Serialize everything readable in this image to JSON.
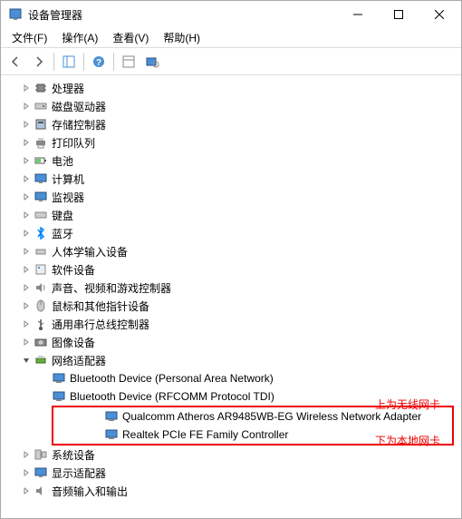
{
  "titlebar": {
    "title": "设备管理器"
  },
  "menubar": {
    "file": "文件(F)",
    "action": "操作(A)",
    "view": "查看(V)",
    "help": "帮助(H)"
  },
  "tree": {
    "items": [
      {
        "label": "处理器"
      },
      {
        "label": "磁盘驱动器"
      },
      {
        "label": "存储控制器"
      },
      {
        "label": "打印队列"
      },
      {
        "label": "电池"
      },
      {
        "label": "计算机"
      },
      {
        "label": "监视器"
      },
      {
        "label": "键盘"
      },
      {
        "label": "蓝牙"
      },
      {
        "label": "人体学输入设备"
      },
      {
        "label": "软件设备"
      },
      {
        "label": "声音、视频和游戏控制器"
      },
      {
        "label": "鼠标和其他指针设备"
      },
      {
        "label": "通用串行总线控制器"
      },
      {
        "label": "图像设备"
      },
      {
        "label": "网络适配器"
      },
      {
        "label": "系统设备"
      },
      {
        "label": "显示适配器"
      },
      {
        "label": "音频输入和输出"
      }
    ],
    "network_children": [
      {
        "label": "Bluetooth Device (Personal Area Network)"
      },
      {
        "label": "Bluetooth Device (RFCOMM Protocol TDI)"
      },
      {
        "label": "Qualcomm Atheros AR9485WB-EG Wireless Network Adapter"
      },
      {
        "label": "Realtek PCIe FE Family Controller"
      }
    ]
  },
  "annotations": {
    "wireless": "上为无线网卡",
    "local": "下为本地网卡"
  }
}
